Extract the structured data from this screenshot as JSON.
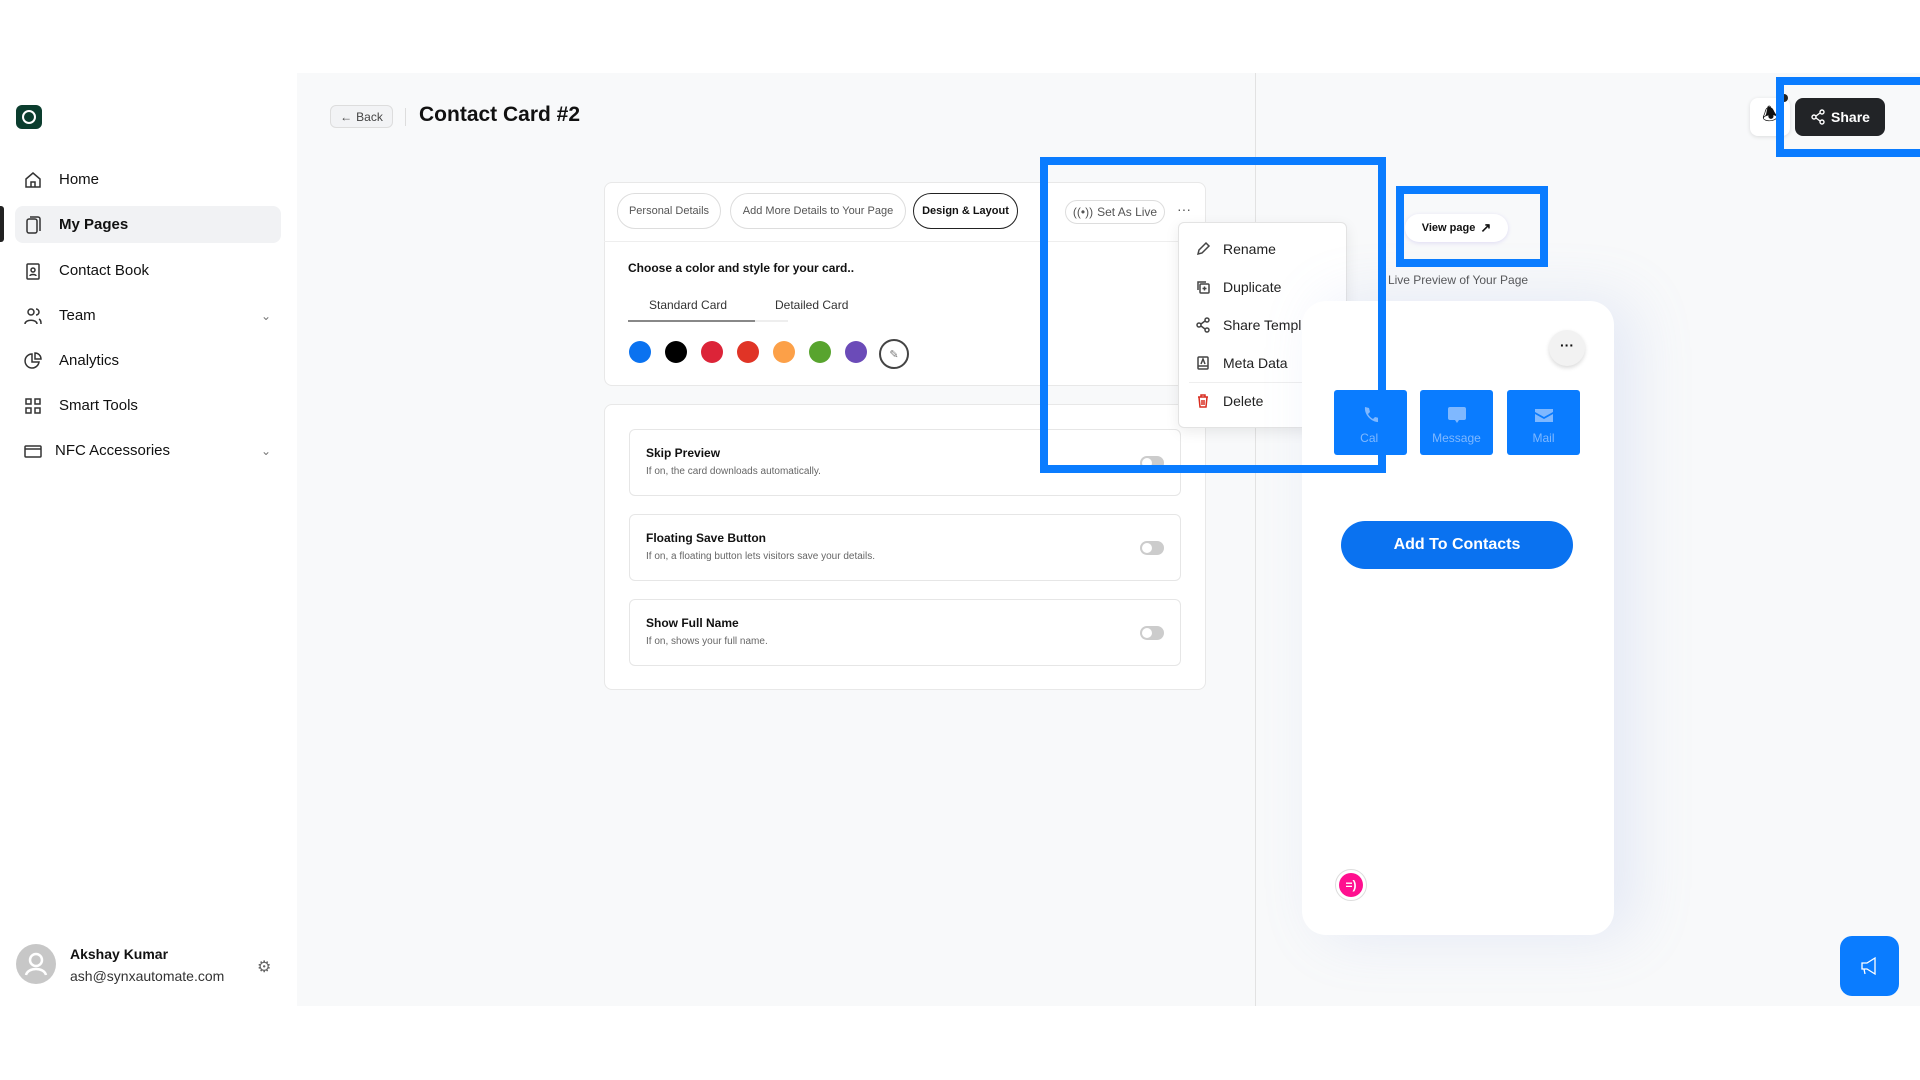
{
  "sidebar": {
    "items": [
      {
        "label": "Home",
        "icon": "home-icon"
      },
      {
        "label": "My Pages",
        "icon": "pages-icon",
        "active": true
      },
      {
        "label": "Contact Book",
        "icon": "contact-book-icon"
      },
      {
        "label": "Team",
        "icon": "team-icon",
        "expandable": true
      },
      {
        "label": "Analytics",
        "icon": "analytics-icon"
      },
      {
        "label": "Smart Tools",
        "icon": "grid-icon"
      },
      {
        "label": "NFC Accessories",
        "icon": "card-icon",
        "expandable": true
      }
    ],
    "user": {
      "name": "Akshay Kumar",
      "email": "ash@synxautomate.com"
    }
  },
  "header": {
    "back_label": "Back",
    "title": "Contact Card #2",
    "share_label": "Share"
  },
  "editor": {
    "tabs": [
      "Personal Details",
      "Add More Details to Your Page",
      "Design & Layout"
    ],
    "active_tab": "Design & Layout",
    "set_live_label": "Set As Live",
    "design": {
      "prompt": "Choose a color and style for your card..",
      "style_tabs": [
        "Standard Card",
        "Detailed Card"
      ],
      "active_style": "Standard Card",
      "colors": [
        "#0a72f0",
        "#000000",
        "#dc2438",
        "#e03426",
        "#fca048",
        "#58a42e",
        "#6b4bb8"
      ]
    },
    "settings": [
      {
        "title": "Skip Preview",
        "desc": "If on, the card downloads automatically.",
        "on": false
      },
      {
        "title": "Floating Save Button",
        "desc": "If on, a floating button lets visitors save your details.",
        "on": false
      },
      {
        "title": "Show Full Name",
        "desc": "If on, shows your full name.",
        "on": false
      }
    ]
  },
  "menu": {
    "items": [
      {
        "label": "Rename"
      },
      {
        "label": "Duplicate"
      },
      {
        "label": "Share Template"
      },
      {
        "label": "Meta Data"
      },
      {
        "label": "Delete"
      }
    ]
  },
  "preview": {
    "view_page_label": "View page",
    "caption": "Live Preview of Your Page",
    "actions": [
      "Call",
      "Message",
      "Mail"
    ],
    "add_contacts_label": "Add To Contacts"
  },
  "colors": {
    "accent": "#0a7cff",
    "highlight": "#0a7cff",
    "danger": "#d92d20"
  }
}
